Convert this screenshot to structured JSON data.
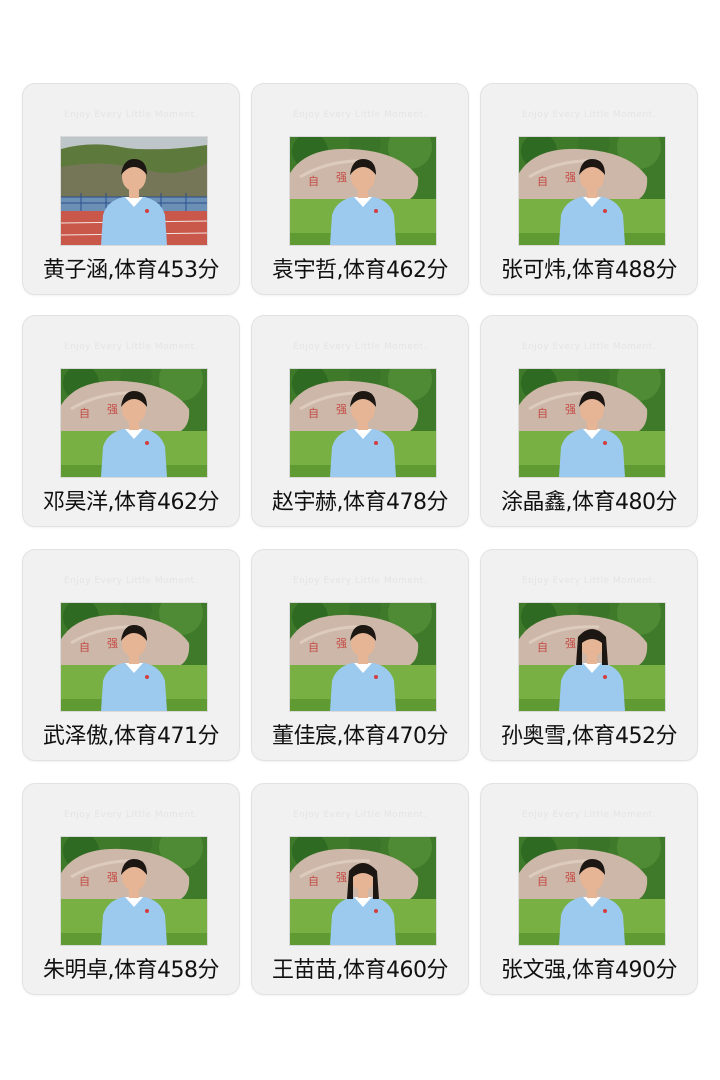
{
  "watermark": "Enjoy Every Little Moment.",
  "students": [
    {
      "caption": "黄子涵,体育453分",
      "photo": "student-photo-track",
      "hair": "short"
    },
    {
      "caption": "袁宇哲,体育462分",
      "photo": "student-photo-rock",
      "hair": "short"
    },
    {
      "caption": "张可炜,体育488分",
      "photo": "student-photo-rock",
      "hair": "short"
    },
    {
      "caption": "邓昊洋,体育462分",
      "photo": "student-photo-rock",
      "hair": "short"
    },
    {
      "caption": "赵宇赫,体育478分",
      "photo": "student-photo-rock",
      "hair": "short"
    },
    {
      "caption": "涂晶鑫,体育480分",
      "photo": "student-photo-rock",
      "hair": "short"
    },
    {
      "caption": "武泽傲,体育471分",
      "photo": "student-photo-rock",
      "hair": "short"
    },
    {
      "caption": "董佳宸,体育470分",
      "photo": "student-photo-rock",
      "hair": "short"
    },
    {
      "caption": "孙奥雪,体育452分",
      "photo": "student-photo-rock",
      "hair": "long"
    },
    {
      "caption": "朱明卓,体育458分",
      "photo": "student-photo-rock",
      "hair": "short"
    },
    {
      "caption": "王苗苗,体育460分",
      "photo": "student-photo-rock",
      "hair": "long"
    },
    {
      "caption": "张文强,体育490分",
      "photo": "student-photo-rock",
      "hair": "short"
    }
  ],
  "colors": {
    "shirt": "#9cc9ee",
    "grass": "#79b043",
    "rock": "#cdb7a8",
    "foliage": "#3f7a2a",
    "track": "#c9574a",
    "hair": "#1d1714",
    "skin": "#e6b595"
  }
}
